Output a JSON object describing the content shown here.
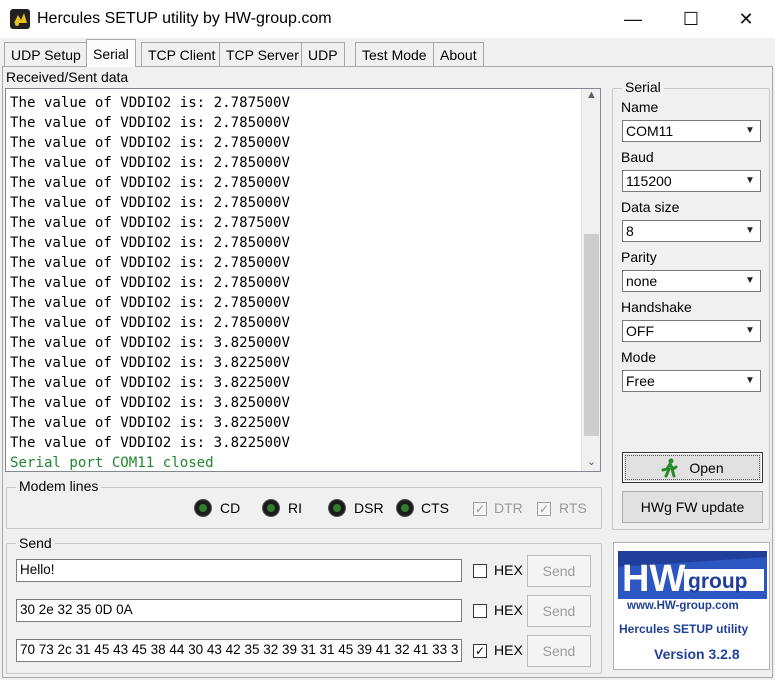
{
  "window": {
    "title": "Hercules SETUP utility by HW-group.com",
    "min_glyph": "—",
    "max_glyph": "☐",
    "close_glyph": "✕"
  },
  "tabs": [
    {
      "label": "UDP Setup"
    },
    {
      "label": "Serial"
    },
    {
      "label": "TCP Client"
    },
    {
      "label": "TCP Server"
    },
    {
      "label": "UDP"
    },
    {
      "label": "Test Mode"
    },
    {
      "label": "About"
    }
  ],
  "active_tab": "Serial",
  "received": {
    "label": "Received/Sent data",
    "lines": [
      "The value of VDDIO2 is: 2.787500V",
      "The value of VDDIO2 is: 2.785000V",
      "The value of VDDIO2 is: 2.785000V",
      "The value of VDDIO2 is: 2.785000V",
      "The value of VDDIO2 is: 2.785000V",
      "The value of VDDIO2 is: 2.785000V",
      "The value of VDDIO2 is: 2.787500V",
      "The value of VDDIO2 is: 2.785000V",
      "The value of VDDIO2 is: 2.785000V",
      "The value of VDDIO2 is: 2.785000V",
      "The value of VDDIO2 is: 2.785000V",
      "The value of VDDIO2 is: 2.785000V",
      "The value of VDDIO2 is: 3.825000V",
      "The value of VDDIO2 is: 3.822500V",
      "The value of VDDIO2 is: 3.822500V",
      "The value of VDDIO2 is: 3.825000V",
      "The value of VDDIO2 is: 3.822500V",
      "The value of VDDIO2 is: 3.822500V"
    ],
    "status_line": "Serial port COM11 closed",
    "status_color": "#22862e"
  },
  "modem": {
    "label": "Modem lines",
    "leds": [
      {
        "label": "CD"
      },
      {
        "label": "RI"
      },
      {
        "label": "DSR"
      },
      {
        "label": "CTS"
      }
    ],
    "checks": [
      {
        "label": "DTR",
        "checked": true,
        "enabled": false,
        "mark": "✓"
      },
      {
        "label": "RTS",
        "checked": true,
        "enabled": false,
        "mark": "✓"
      }
    ]
  },
  "send": {
    "label": "Send",
    "rows": [
      {
        "value": "Hello!",
        "hex_label": "HEX",
        "hex_checked": false,
        "hex_mark": "",
        "button": "Send"
      },
      {
        "value": "30 2e 32 35 0D 0A",
        "hex_label": "HEX",
        "hex_checked": false,
        "hex_mark": "",
        "button": "Send"
      },
      {
        "value": "70 73 2c 31 45 43 45 38 44 30 43 42 35 32 39 31 31 45 39 41 32 41 33 3",
        "hex_label": "HEX",
        "hex_checked": true,
        "hex_mark": "✓",
        "button": "Send"
      }
    ]
  },
  "serial": {
    "label": "Serial",
    "fields": [
      {
        "label": "Name",
        "value": "COM11"
      },
      {
        "label": "Baud",
        "value": "115200"
      },
      {
        "label": "Data size",
        "value": "8"
      },
      {
        "label": "Parity",
        "value": "none"
      },
      {
        "label": "Handshake",
        "value": "OFF"
      },
      {
        "label": "Mode",
        "value": "Free"
      }
    ],
    "open_button": "Open",
    "fw_button": "HWg FW update"
  },
  "logo": {
    "brand_hw": "HW",
    "brand_group": "group",
    "url": "www.HW-group.com",
    "product": "Hercules SETUP utility",
    "version": "Version  3.2.8",
    "brand_color": "#1f3f9a"
  }
}
